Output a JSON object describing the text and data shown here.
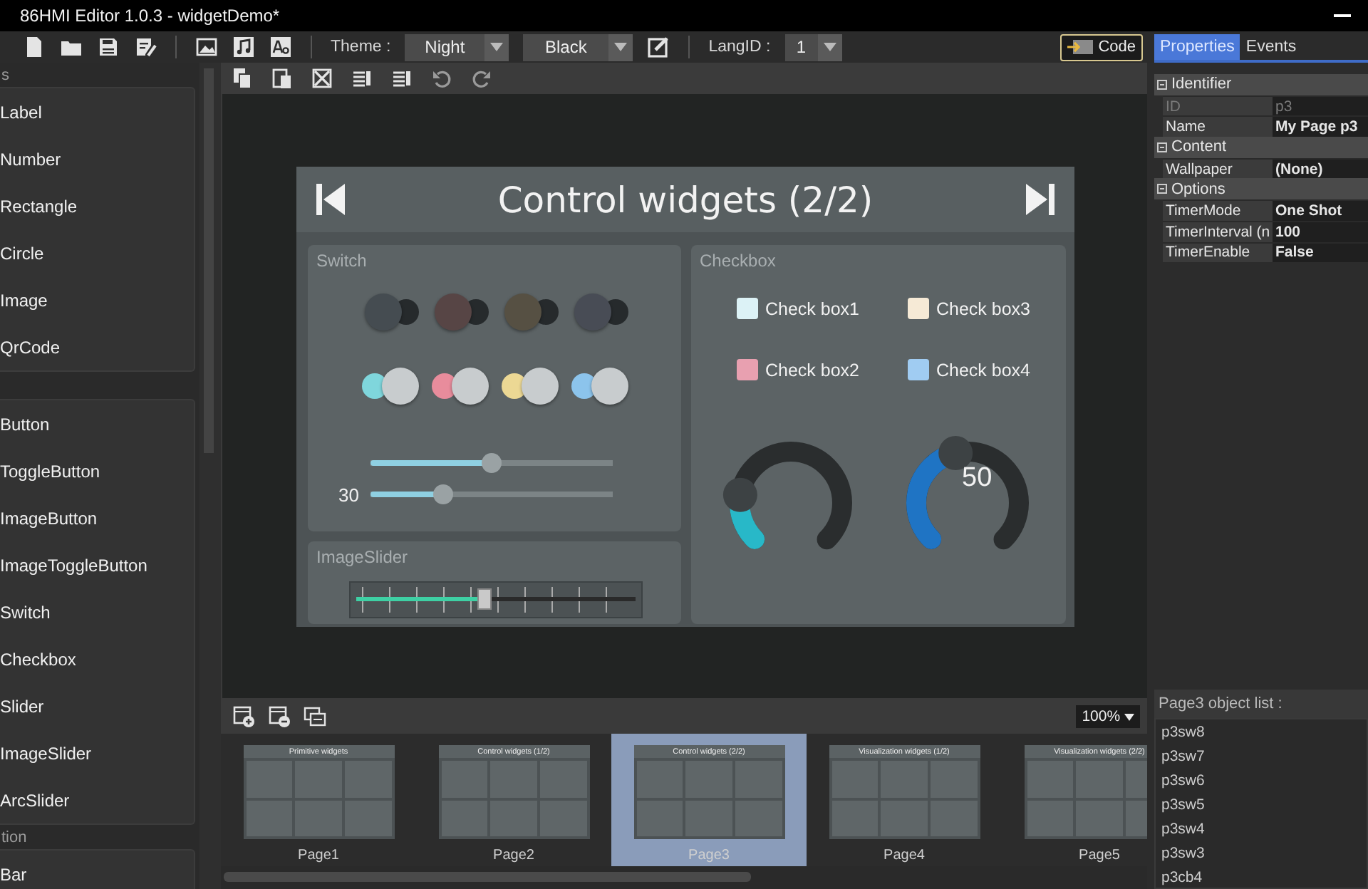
{
  "window": {
    "title": "86HMI Editor 1.0.3 - widgetDemo*"
  },
  "toolbar": {
    "theme_label": "Theme :",
    "theme": "Night",
    "color_scheme": "Black",
    "lang_label": "LangID :",
    "lang": "1",
    "code_button": "Code"
  },
  "widget_panel": {
    "groups": [
      {
        "header": "s",
        "items": [
          "Label",
          "Number",
          "Rectangle",
          "Circle",
          "Image",
          "QrCode"
        ]
      },
      {
        "items": [
          "Button",
          "ToggleButton",
          "ImageButton",
          "ImageToggleButton",
          "Switch",
          "Checkbox",
          "Slider",
          "ImageSlider",
          "ArcSlider"
        ]
      },
      {
        "header": "tion",
        "items": [
          "Bar"
        ]
      }
    ]
  },
  "canvas": {
    "page": {
      "title": "Control widgets (2/2)",
      "switch_panel": {
        "title": "Switch",
        "switches": [
          {
            "on": false,
            "color": "#454c51"
          },
          {
            "on": false,
            "color": "#574545"
          },
          {
            "on": false,
            "color": "#565043"
          },
          {
            "on": false,
            "color": "#484c55"
          },
          {
            "on": true,
            "color": "#7fd6dc"
          },
          {
            "on": true,
            "color": "#e88c9c"
          },
          {
            "on": true,
            "color": "#ecd894"
          },
          {
            "on": true,
            "color": "#8cc4ec"
          }
        ],
        "sliders": [
          {
            "level": 0.5
          },
          {
            "label": "30",
            "level": 0.3
          }
        ]
      },
      "image_slider": {
        "title": "ImageSlider",
        "level": 0.46
      },
      "checkbox_panel": {
        "title": "Checkbox",
        "checkboxes": [
          {
            "label": "Check box1",
            "checked": false,
            "color": "#dcf2f6"
          },
          {
            "label": "Check box3",
            "checked": false,
            "color": "#f6ead6"
          },
          {
            "label": "Check box2",
            "checked": false,
            "color": "#e8a0b0"
          },
          {
            "label": "Check box4",
            "checked": false,
            "color": "#a0ccf2"
          }
        ],
        "arcs": [
          {
            "level": 0.2,
            "color": "#28b8c8"
          },
          {
            "level": 0.45,
            "color": "#1f74c4",
            "reading": "50"
          }
        ]
      }
    }
  },
  "pages": {
    "zoom": "100%",
    "thumbnails": [
      {
        "title": "Primitive widgets",
        "label": "Page1",
        "selected": false
      },
      {
        "title": "Control widgets (1/2)",
        "label": "Page2",
        "selected": false
      },
      {
        "title": "Control widgets (2/2)",
        "label": "Page3",
        "selected": true
      },
      {
        "title": "Visualization widgets (1/2)",
        "label": "Page4",
        "selected": false
      },
      {
        "title": "Visualization widgets (2/2)",
        "label": "Page5",
        "selected": false
      }
    ]
  },
  "properties": {
    "tabs": [
      {
        "label": "Properties",
        "selected": true
      },
      {
        "label": "Events",
        "selected": false
      }
    ],
    "sections": [
      {
        "name": "Identifier",
        "expanded": true,
        "rows": [
          {
            "name": "ID",
            "value": "p3",
            "disabled": true
          },
          {
            "name": "Name",
            "value": "My Page p3",
            "disabled": false
          }
        ]
      },
      {
        "name": "Content",
        "expanded": true,
        "rows": [
          {
            "name": "Wallpaper",
            "value": "(None)",
            "disabled": false
          }
        ]
      },
      {
        "name": "Options",
        "expanded": true,
        "rows": [
          {
            "name": "TimerMode",
            "value": "One Shot",
            "disabled": false
          },
          {
            "name": "TimerInterval (n",
            "value": "100",
            "disabled": false
          },
          {
            "name": "TimerEnable",
            "value": "False",
            "disabled": false
          }
        ]
      }
    ]
  },
  "object_list": {
    "title": "Page3 object list :",
    "items": [
      "p3sw8",
      "p3sw7",
      "p3sw6",
      "p3sw5",
      "p3sw4",
      "p3sw3",
      "p3cb4"
    ]
  }
}
